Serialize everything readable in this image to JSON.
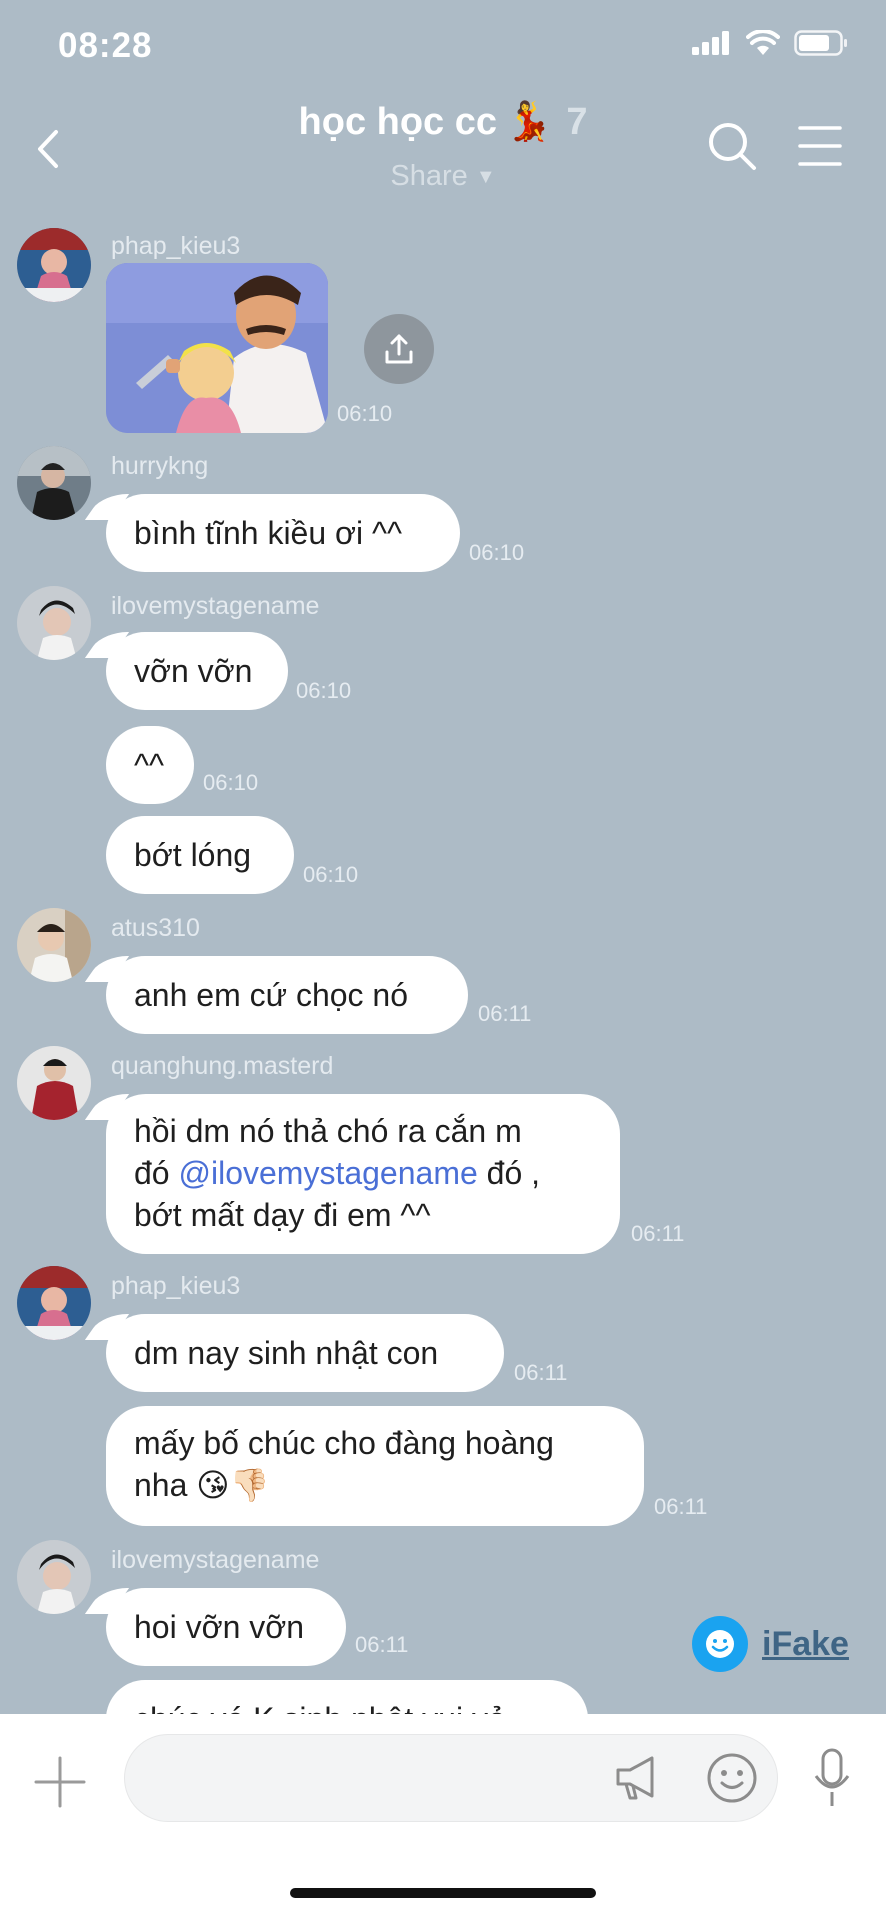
{
  "status_bar": {
    "time": "08:28"
  },
  "header": {
    "title": "học học cc",
    "title_emoji": "💃",
    "member_count": "7",
    "subtitle": "Share"
  },
  "messages": [
    {
      "user": "phap_kieu3",
      "type": "image",
      "time": "06:10"
    },
    {
      "user": "hurrykng",
      "text": "bình tĩnh kiều ơi ^^",
      "time": "06:10"
    },
    {
      "user": "ilovemystagename",
      "text": "vỡn vỡn",
      "time": "06:10"
    },
    {
      "text": "^^",
      "time": "06:10"
    },
    {
      "text": "bớt lóng",
      "time": "06:10"
    },
    {
      "user": "atus310",
      "text": "anh em cứ chọc nó",
      "time": "06:11"
    },
    {
      "user": "quanghung.masterd",
      "line1": "hồi dm nó thả chó ra cắn m",
      "line2_pre": "đó ",
      "mention": "@ilovemystagename",
      "line2_post": " đó ,",
      "line3": "bớt mất dạy đi em ^^",
      "time": "06:11"
    },
    {
      "user": "phap_kieu3",
      "text": "dm nay sinh nhật con",
      "time": "06:11"
    },
    {
      "line1": "mấy bố chúc cho đàng hoàng",
      "line2": "nha 😘👎🏻",
      "time": "06:11"
    },
    {
      "user": "ilovemystagename",
      "text": "hoi vỡn vỡn",
      "time": "06:11"
    },
    {
      "text": "chúc vé K sinh nhật vui vẻ"
    }
  ],
  "watermark": {
    "label": "iFake"
  },
  "colors": {
    "background": "#adbbc6",
    "bubble": "#ffffff",
    "mention": "#4a6fd6"
  }
}
